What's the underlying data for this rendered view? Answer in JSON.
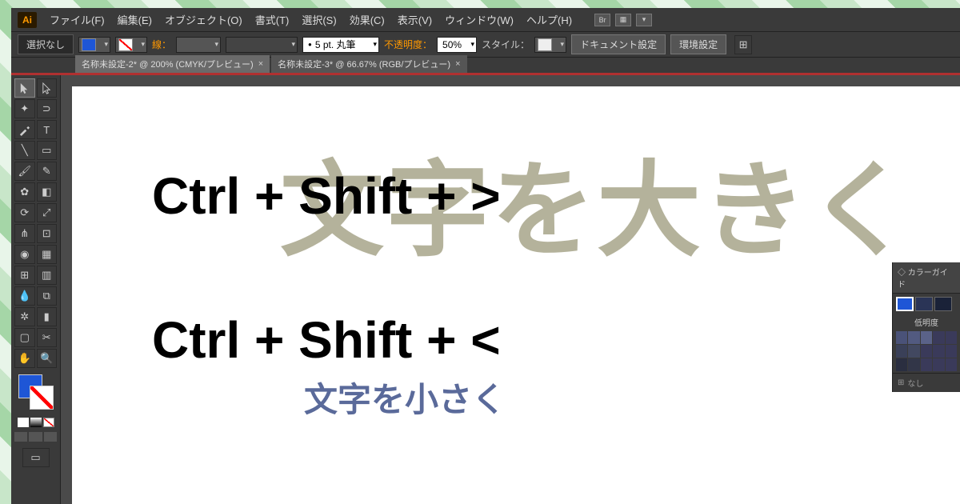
{
  "menu": {
    "items": [
      "ファイル(F)",
      "編集(E)",
      "オブジェクト(O)",
      "書式(T)",
      "選択(S)",
      "効果(C)",
      "表示(V)",
      "ウィンドウ(W)",
      "ヘルプ(H)"
    ]
  },
  "logo": "Ai",
  "controlbar": {
    "selection": "選択なし",
    "stroke_label": "線：",
    "stroke_weight": "",
    "brush": "5 pt. 丸筆",
    "opacity_label": "不透明度：",
    "opacity_value": "50%",
    "style_label": "スタイル：",
    "doc_setup": "ドキュメント設定",
    "prefs": "環境設定"
  },
  "tabs": [
    {
      "label": "名称未設定-2* @ 200% (CMYK/プレビュー)",
      "active": true
    },
    {
      "label": "名称未設定-3* @ 66.67% (RGB/プレビュー)",
      "active": false
    }
  ],
  "canvas": {
    "bg_text": "文字を大きく",
    "shortcut1": "Ctrl + Shift + >",
    "shortcut2": "Ctrl + Shift + <",
    "small_text": "文字を小さく"
  },
  "panel": {
    "title": "カラーガイド",
    "lightness": "低明度",
    "none": "なし"
  },
  "brush_bullet": "●"
}
